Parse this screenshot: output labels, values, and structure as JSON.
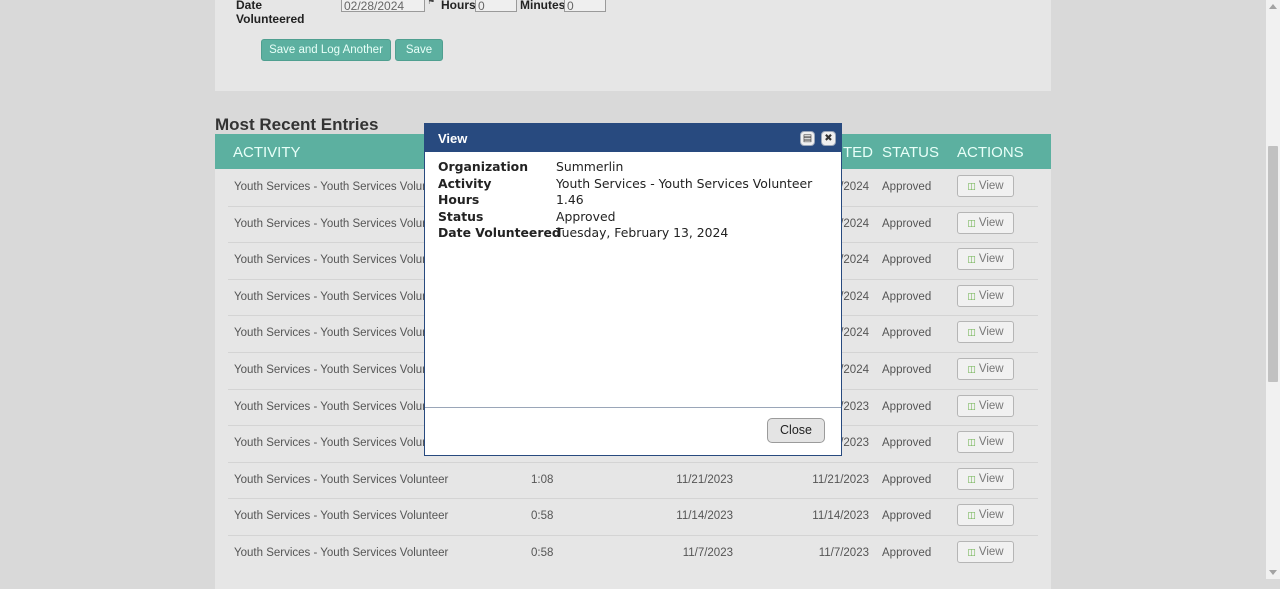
{
  "form": {
    "date_label": "Date Volunteered",
    "date_value": "02/28/2024",
    "hours_label": "Hours",
    "hours_value": "0",
    "minutes_label": "Minutes",
    "minutes_value": "0",
    "save_log_label": "Save and Log Another",
    "save_label": "Save"
  },
  "recent": {
    "title": "Most Recent Entries",
    "headers": {
      "activity": "ACTIVITY",
      "updated_fragment": "TED",
      "status": "STATUS",
      "actions": "ACTIONS"
    },
    "rows": [
      {
        "activity": "Youth Services - Youth Services Volunte",
        "hours": "",
        "date": "",
        "updated": "/2024",
        "status": "Approved",
        "action": "View"
      },
      {
        "activity": "Youth Services - Youth Services Volunte",
        "hours": "",
        "date": "",
        "updated": "/2024",
        "status": "Approved",
        "action": "View"
      },
      {
        "activity": "Youth Services - Youth Services Volunte",
        "hours": "",
        "date": "",
        "updated": "/2024",
        "status": "Approved",
        "action": "View"
      },
      {
        "activity": "Youth Services - Youth Services Volunte",
        "hours": "",
        "date": "",
        "updated": "/2024",
        "status": "Approved",
        "action": "View"
      },
      {
        "activity": "Youth Services - Youth Services Volunte",
        "hours": "",
        "date": "",
        "updated": "/2024",
        "status": "Approved",
        "action": "View"
      },
      {
        "activity": "Youth Services - Youth Services Volunte",
        "hours": "",
        "date": "",
        "updated": "/2024",
        "status": "Approved",
        "action": "View"
      },
      {
        "activity": "Youth Services - Youth Services Volunte",
        "hours": "",
        "date": "",
        "updated": "/2023",
        "status": "Approved",
        "action": "View"
      },
      {
        "activity": "Youth Services - Youth Services Volunte",
        "hours": "",
        "date": "",
        "updated": "/2023",
        "status": "Approved",
        "action": "View"
      },
      {
        "activity": "Youth Services - Youth Services Volunteer",
        "hours": "1:08",
        "date": "11/21/2023",
        "updated": "11/21/2023",
        "status": "Approved",
        "action": "View"
      },
      {
        "activity": "Youth Services - Youth Services Volunteer",
        "hours": "0:58",
        "date": "11/14/2023",
        "updated": "11/14/2023",
        "status": "Approved",
        "action": "View"
      },
      {
        "activity": "Youth Services - Youth Services Volunteer",
        "hours": "0:58",
        "date": "11/7/2023",
        "updated": "11/7/2023",
        "status": "Approved",
        "action": "View"
      }
    ]
  },
  "modal": {
    "title": "View",
    "fields": [
      {
        "key": "Organization",
        "value": "Summerlin"
      },
      {
        "key": "Activity",
        "value": "Youth Services - Youth Services Volunteer"
      },
      {
        "key": "Hours",
        "value": "1.46"
      },
      {
        "key": "Status",
        "value": "Approved"
      },
      {
        "key": "Date Volunteered",
        "value": "Tuesday, February 13, 2024"
      }
    ],
    "close_label": "Close",
    "print_icon": "print-icon",
    "close_icon": "close-icon"
  },
  "colors": {
    "accent": "#5cb0a0",
    "modal_header": "#284a7f",
    "background": "#d9d9d9",
    "panel": "#e6e6e6"
  }
}
